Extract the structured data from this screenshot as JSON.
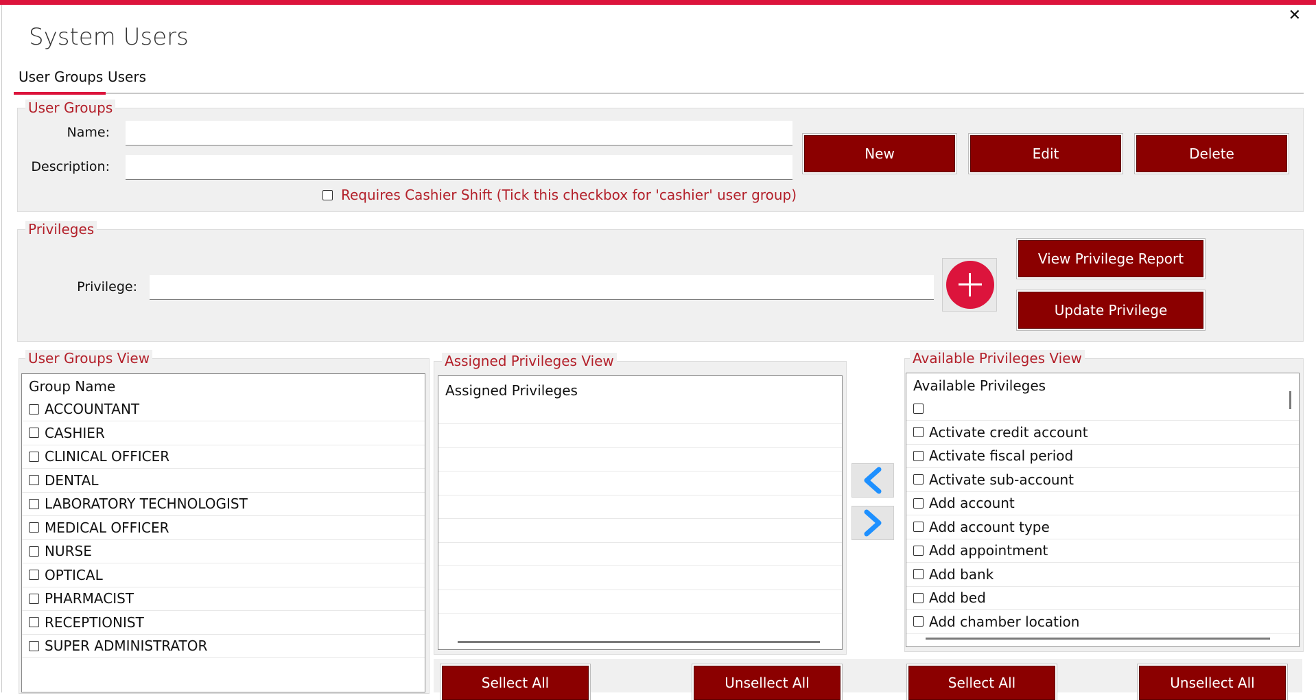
{
  "window": {
    "title": "System Users",
    "close_glyph": "✕"
  },
  "tabs": [
    {
      "label": "User Groups"
    },
    {
      "label": "Users"
    }
  ],
  "user_groups": {
    "legend": "User Groups",
    "name_label": "Name:",
    "name_value": "",
    "description_label": "Description:",
    "description_value": "",
    "cashier_label": "Requires Cashier Shift (Tick this checkbox for 'cashier' user group)",
    "buttons": {
      "new": "New",
      "edit": "Edit",
      "delete": "Delete"
    }
  },
  "privileges": {
    "legend": "Privileges",
    "privilege_label": "Privilege:",
    "privilege_value": "",
    "view_report": "View Privilege Report",
    "update": "Update Privilege"
  },
  "user_groups_view": {
    "legend": "User Groups View",
    "header": "Group Name",
    "items": [
      "ACCOUNTANT",
      "CASHIER",
      "CLINICAL OFFICER",
      "DENTAL",
      "LABORATORY TECHNOLOGIST",
      "MEDICAL OFFICER",
      "NURSE",
      "OPTICAL",
      "PHARMACIST",
      "RECEPTIONIST",
      "SUPER ADMINISTRATOR"
    ]
  },
  "assigned_view": {
    "legend": "Assigned Privileges View",
    "header": "Assigned Privileges"
  },
  "available_view": {
    "legend": "Available Privileges View",
    "header": "Available Privileges",
    "items": [
      "",
      "Activate credit account",
      "Activate fiscal period",
      "Activate sub-account",
      "Add account",
      "Add account type",
      "Add appointment",
      "Add bank",
      "Add bed",
      "Add chamber location"
    ]
  },
  "bottom_buttons": {
    "select_all_left": "Sellect All",
    "unselect_all_left": "Unsellect All",
    "select_all_right": "Sellect All",
    "unselect_all_right": "Unsellect All"
  },
  "colors": {
    "accent": "#dc143c",
    "button": "#8b0000",
    "legend": "#b3202a",
    "arrow": "#1e90ff"
  }
}
